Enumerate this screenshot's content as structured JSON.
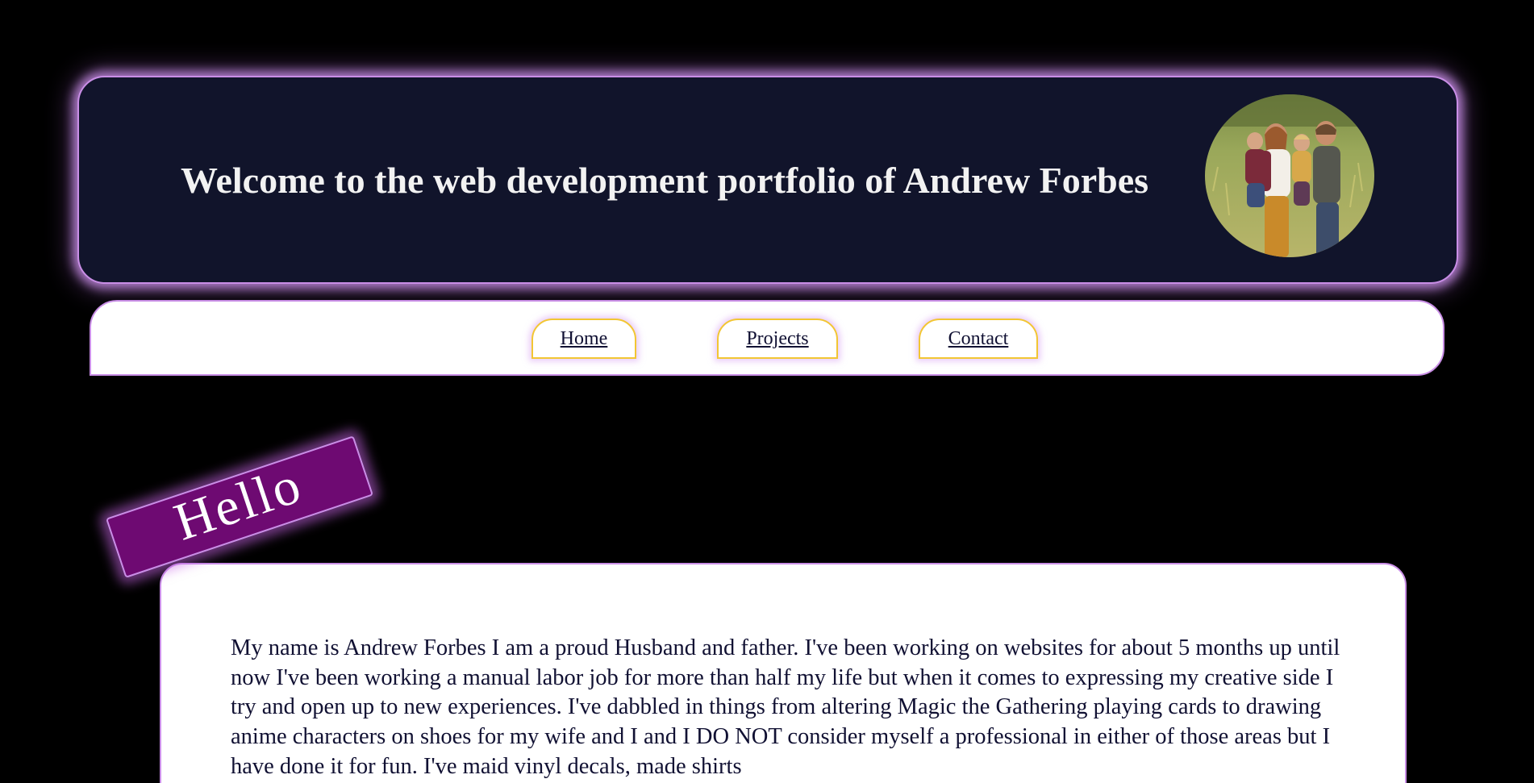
{
  "header": {
    "title": "Welcome to the web development portfolio of Andrew Forbes",
    "avatar_alt": "family-photo"
  },
  "nav": {
    "items": [
      {
        "label": "Home"
      },
      {
        "label": "Projects"
      },
      {
        "label": "Contact"
      }
    ]
  },
  "hello_tag": {
    "label": "Hello"
  },
  "intro": {
    "text": "My name is Andrew Forbes I am a proud Husband and father. I've been working on websites for about 5 months up until now I've been working a manual labor job for more than half my life but when it comes to expressing my creative side I try and open up to new experiences. I've dabbled in things from altering Magic the Gathering playing cards to drawing anime characters on shoes for my wife and I and I DO NOT consider myself a professional in either of those areas but I have done it for fun. I've maid vinyl decals, made shirts"
  },
  "colors": {
    "background": "#000000",
    "header_bg": "#11142b",
    "glow": "#c98ee6",
    "nav_button_border": "#f2c633",
    "hello_bg": "#6e0a72",
    "text_dark": "#111133"
  }
}
